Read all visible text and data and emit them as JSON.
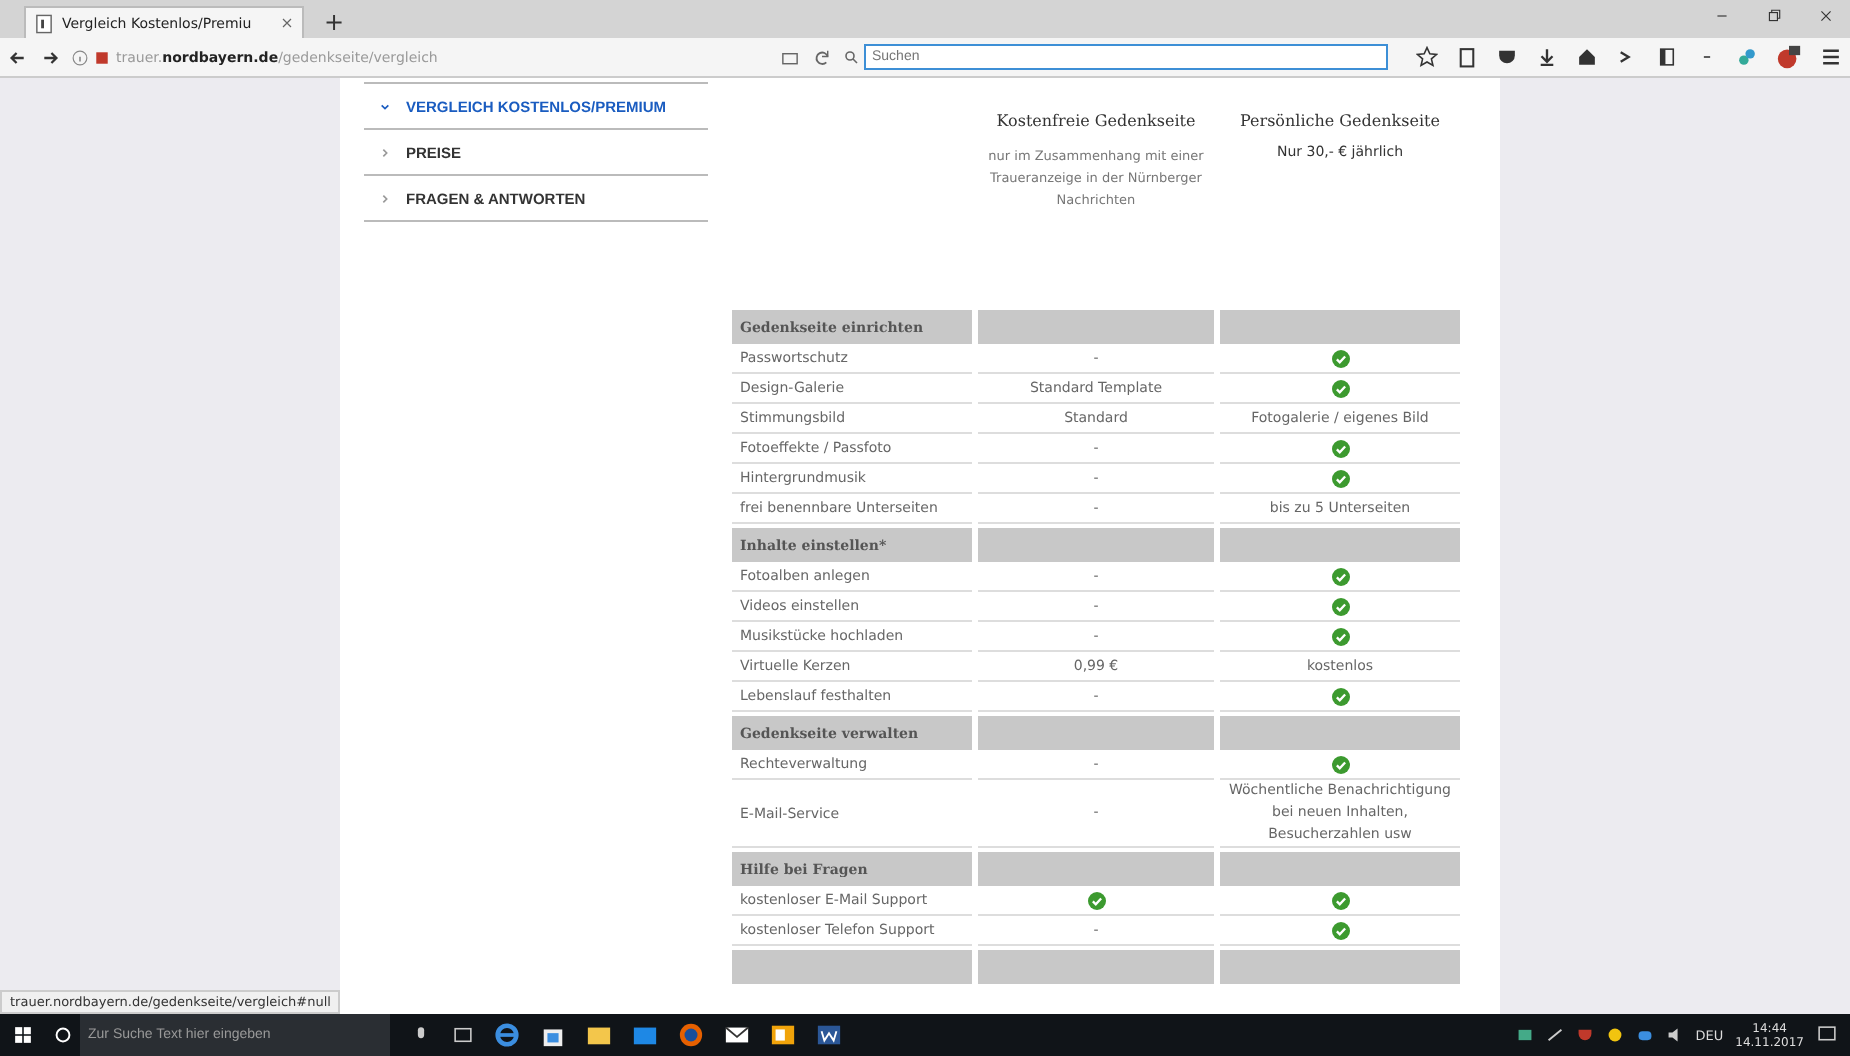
{
  "browser": {
    "tab_title": "Vergleich Kostenlos/Premiu",
    "new_tab": "+",
    "url_host_prefix": "trauer.",
    "url_domain": "nordbayern.de",
    "url_path": "/gedenkseite/vergleich",
    "search": {
      "placeholder": "Suchen"
    }
  },
  "sidebar": {
    "items": [
      {
        "label": "VERGLEICH KOSTENLOS/PREMIUM",
        "selected": true
      },
      {
        "label": "PREISE",
        "selected": false
      },
      {
        "label": "FRAGEN & ANTWORTEN",
        "selected": false
      }
    ]
  },
  "comparison": {
    "columns": [
      {
        "title": "Kostenfreie Gedenkseite",
        "note": "nur im Zusammenhang mit einer Traueranzeige in der Nürnberger Nachrichten"
      },
      {
        "title": "Persönliche Gedenkseite",
        "price": "Nur 30,- € jährlich"
      }
    ],
    "rows": [
      {
        "kind": "section",
        "label": "Gedenkseite einrichten"
      },
      {
        "kind": "row",
        "label": "Passwortschutz",
        "free": {
          "kind": "text",
          "text": "-"
        },
        "premium": {
          "kind": "check"
        }
      },
      {
        "kind": "row",
        "label": "Design-Galerie",
        "free": {
          "kind": "text",
          "text": "Standard Template"
        },
        "premium": {
          "kind": "check"
        }
      },
      {
        "kind": "row",
        "label": "Stimmungsbild",
        "free": {
          "kind": "text",
          "text": "Standard"
        },
        "premium": {
          "kind": "text",
          "text": "Fotogalerie / eigenes Bild"
        }
      },
      {
        "kind": "row",
        "label": "Fotoeffekte / Passfoto",
        "free": {
          "kind": "text",
          "text": "-"
        },
        "premium": {
          "kind": "check"
        }
      },
      {
        "kind": "row",
        "label": "Hintergrundmusik",
        "free": {
          "kind": "text",
          "text": "-"
        },
        "premium": {
          "kind": "check"
        }
      },
      {
        "kind": "row",
        "label": "frei benennbare Unterseiten",
        "free": {
          "kind": "text",
          "text": "-"
        },
        "premium": {
          "kind": "text",
          "text": "bis zu 5 Unterseiten"
        }
      },
      {
        "kind": "section",
        "label": "Inhalte einstellen*"
      },
      {
        "kind": "row",
        "label": "Fotoalben anlegen",
        "free": {
          "kind": "text",
          "text": "-"
        },
        "premium": {
          "kind": "check"
        }
      },
      {
        "kind": "row",
        "label": "Videos einstellen",
        "free": {
          "kind": "text",
          "text": "-"
        },
        "premium": {
          "kind": "check"
        }
      },
      {
        "kind": "row",
        "label": "Musikstücke hochladen",
        "free": {
          "kind": "text",
          "text": "-"
        },
        "premium": {
          "kind": "check"
        }
      },
      {
        "kind": "row",
        "label": "Virtuelle Kerzen",
        "free": {
          "kind": "text",
          "text": "0,99 €"
        },
        "premium": {
          "kind": "text",
          "text": "kostenlos"
        }
      },
      {
        "kind": "row",
        "label": "Lebenslauf festhalten",
        "free": {
          "kind": "text",
          "text": "-"
        },
        "premium": {
          "kind": "check"
        }
      },
      {
        "kind": "section",
        "label": "Gedenkseite verwalten"
      },
      {
        "kind": "row",
        "label": "Rechteverwaltung",
        "free": {
          "kind": "text",
          "text": "-"
        },
        "premium": {
          "kind": "check"
        }
      },
      {
        "kind": "row",
        "label": "E-Mail-Service",
        "free": {
          "kind": "text",
          "text": "-"
        },
        "premium": {
          "kind": "text",
          "text": "Wöchentliche Benachrichtigung bei neuen Inhalten, Besucherzahlen usw"
        }
      },
      {
        "kind": "section",
        "label": "Hilfe bei Fragen"
      },
      {
        "kind": "row",
        "label": "kostenloser E-Mail Support",
        "free": {
          "kind": "check"
        },
        "premium": {
          "kind": "check"
        }
      },
      {
        "kind": "row",
        "label": "kostenloser Telefon Support",
        "free": {
          "kind": "text",
          "text": "-"
        },
        "premium": {
          "kind": "check"
        }
      },
      {
        "kind": "section"
      }
    ]
  },
  "status_link": "trauer.nordbayern.de/gedenkseite/vergleich#null",
  "taskbar": {
    "search_placeholder": "Zur Suche Text hier eingeben",
    "language": "DEU",
    "time": "14:44",
    "date": "14.11.2017"
  }
}
